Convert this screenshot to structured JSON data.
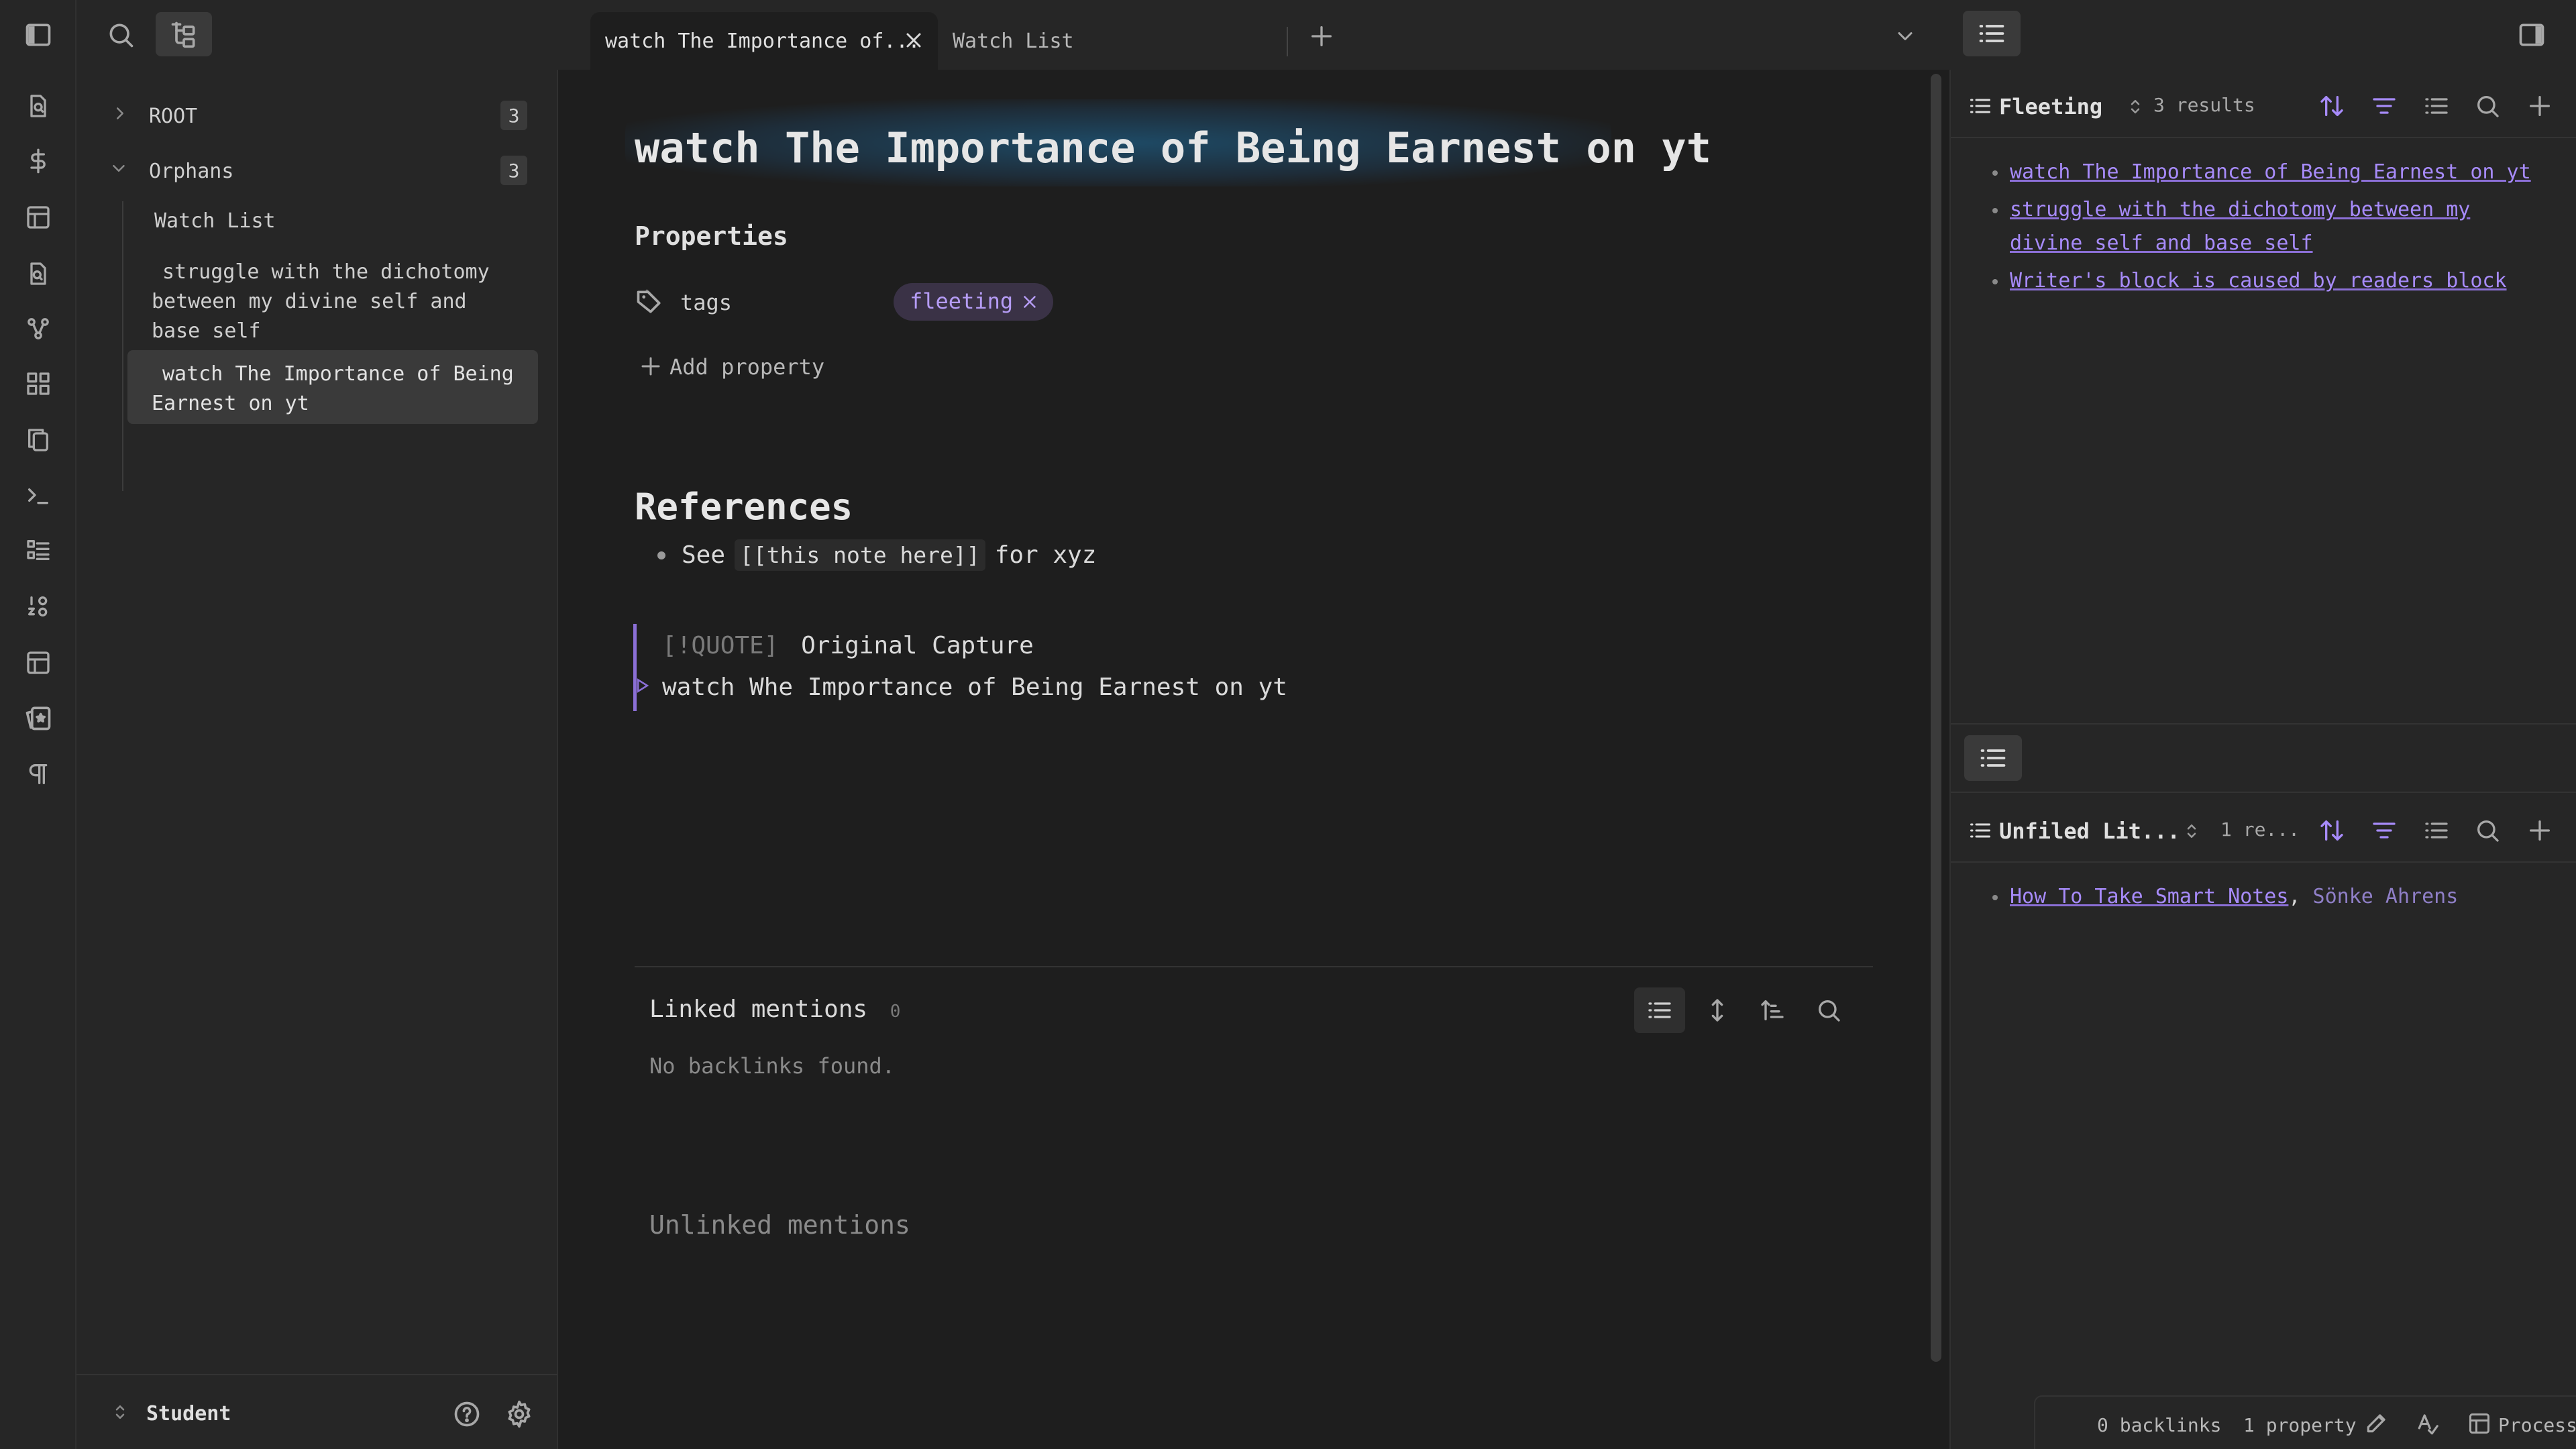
{
  "tabs": [
    {
      "title": "watch The Importance of...",
      "active": true
    },
    {
      "title": "Watch List",
      "active": false
    }
  ],
  "explorer": {
    "items": [
      {
        "label": "ROOT",
        "count": "3"
      },
      {
        "label": "Orphans",
        "count": "3"
      }
    ],
    "children": [
      "Watch List",
      "struggle with the dichotomy between my divine self and base self",
      "watch The Importance of Being Earnest on yt"
    ],
    "vault_name": "Student"
  },
  "note": {
    "title": "watch The Importance of Being Earnest on yt",
    "properties_heading": "Properties",
    "property_key": "tags",
    "tag": "fleeting",
    "add_property": "Add property",
    "references_heading": "References",
    "bullet_prefix": "See",
    "bullet_code": "[[this note here]]",
    "bullet_suffix": "for xyz",
    "quote_marker": "[!QUOTE]",
    "quote_title": "Original Capture",
    "quote_body": "watch Whe Importance of Being Earnest on yt"
  },
  "backlinks": {
    "linked_label": "Linked mentions",
    "linked_count": "0",
    "empty_text": "No backlinks found.",
    "unlinked_label": "Unlinked mentions"
  },
  "right_top_panel": {
    "view_name": "Fleeting",
    "results": "3 results",
    "items": [
      "watch The Importance of Being Earnest on yt",
      "struggle with the dichotomy between my divine self and base self",
      "Writer's block is caused by readers block"
    ]
  },
  "right_bottom_panel": {
    "view_name": "Unfiled Lit...",
    "results": "1 re...",
    "item_link": "How To Take Smart Notes",
    "item_author": "Sönke Ahrens"
  },
  "status_bar": {
    "backlinks": "0 backlinks",
    "properties": "1 property",
    "process": "Process"
  },
  "colors": {
    "accent": "#a78bfa",
    "background": "#1e1e1e",
    "panel": "#262626"
  }
}
